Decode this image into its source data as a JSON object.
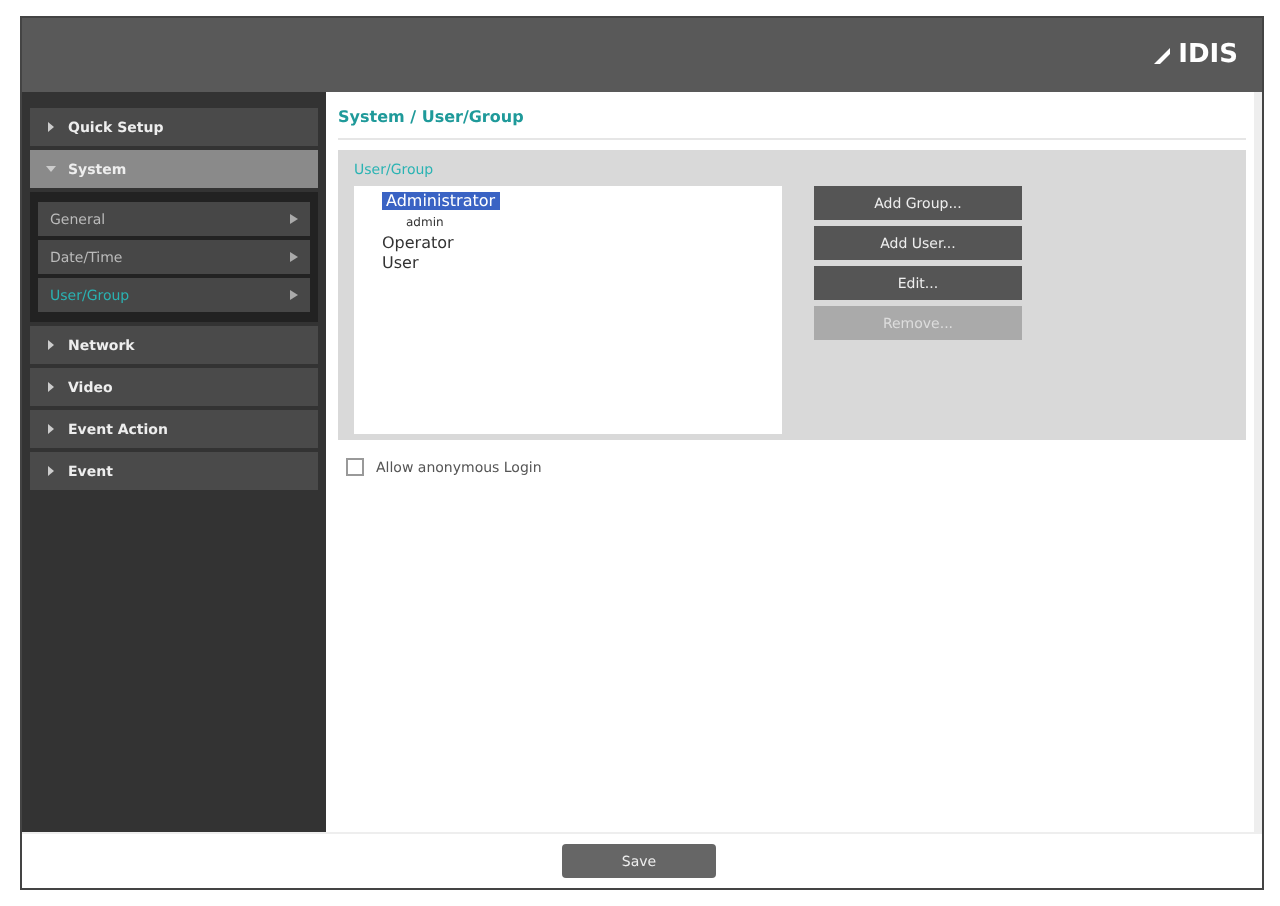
{
  "logo": {
    "text": "IDIS"
  },
  "menu": [
    {
      "label": "Quick Setup",
      "expanded": false
    },
    {
      "label": "System",
      "expanded": true,
      "children": [
        {
          "label": "General",
          "selected": false
        },
        {
          "label": "Date/Time",
          "selected": false
        },
        {
          "label": "User/Group",
          "selected": true
        }
      ]
    },
    {
      "label": "Network",
      "expanded": false
    },
    {
      "label": "Video",
      "expanded": false
    },
    {
      "label": "Event Action",
      "expanded": false
    },
    {
      "label": "Event",
      "expanded": false
    }
  ],
  "breadcrumb": "System / User/Group",
  "group_box": {
    "title": "User/Group",
    "tree": [
      {
        "label": "Administrator",
        "selected": true,
        "children": [
          {
            "label": "admin",
            "selected": false
          }
        ]
      },
      {
        "label": "Operator",
        "selected": false
      },
      {
        "label": "User",
        "selected": false
      }
    ],
    "buttons": [
      {
        "label": "Add Group...",
        "disabled": false
      },
      {
        "label": "Add User...",
        "disabled": false
      },
      {
        "label": "Edit...",
        "disabled": false
      },
      {
        "label": "Remove...",
        "disabled": true
      }
    ]
  },
  "anonymous_login": {
    "label": "Allow anonymous Login",
    "checked": false
  },
  "save_button": "Save"
}
